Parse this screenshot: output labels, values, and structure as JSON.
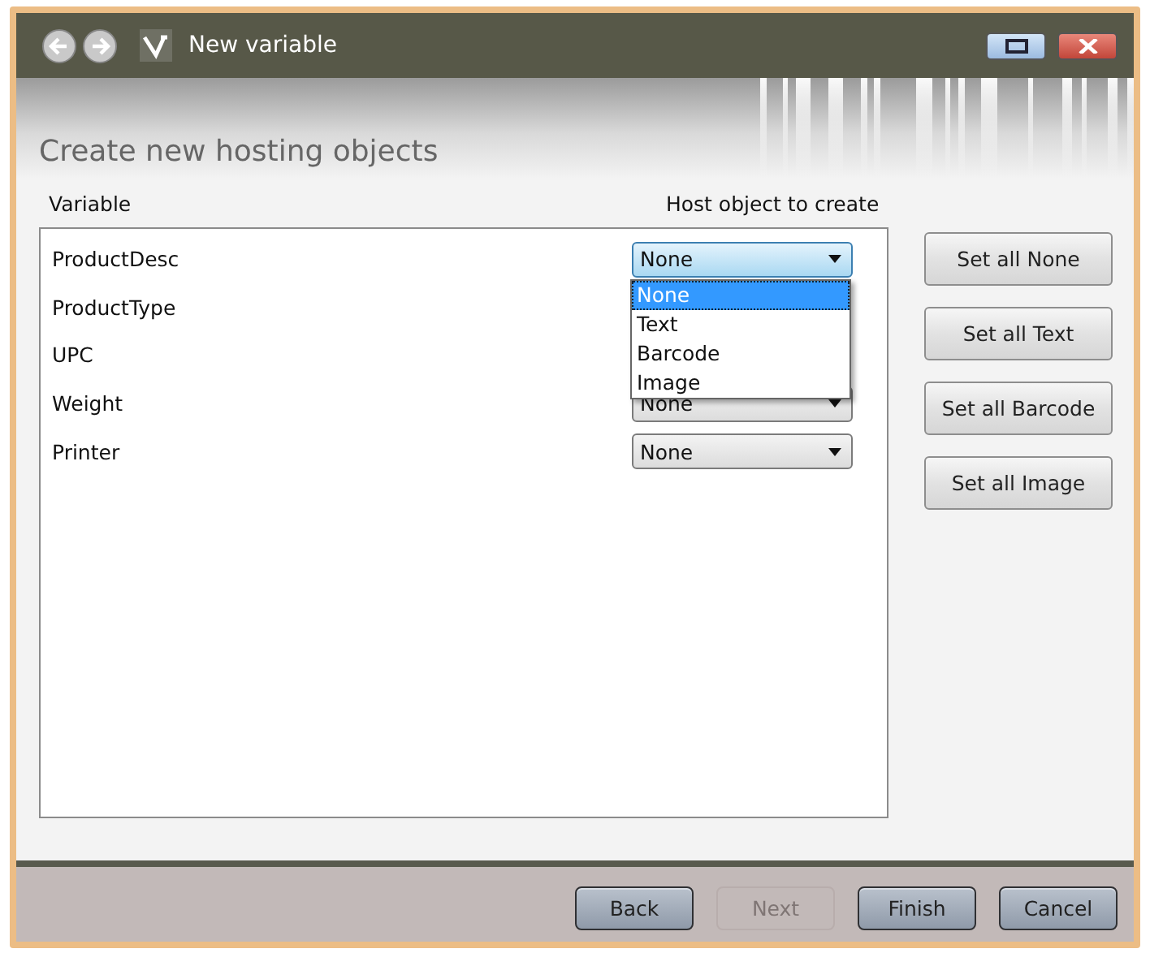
{
  "window": {
    "title": "New variable"
  },
  "header": {
    "title": "Create new hosting objects"
  },
  "columns": [
    "Variable",
    "Host object to create"
  ],
  "rows": [
    {
      "name": "ProductDesc",
      "combo": {
        "value": "None",
        "open": true
      }
    },
    {
      "name": "ProductType"
    },
    {
      "name": "UPC"
    },
    {
      "name": "Weight",
      "combo": {
        "value": "None",
        "open": false
      }
    },
    {
      "name": "Printer",
      "combo": {
        "value": "None",
        "open": false
      }
    }
  ],
  "dropdown": {
    "options": [
      {
        "label": "None",
        "selected": true
      },
      {
        "label": "Text",
        "selected": false
      },
      {
        "label": "Barcode",
        "selected": false
      },
      {
        "label": "Image",
        "selected": false
      }
    ]
  },
  "side_buttons": [
    "Set all None",
    "Set all Text",
    "Set all Barcode",
    "Set all Image"
  ],
  "footer_buttons": [
    {
      "label": "Back",
      "disabled": false
    },
    {
      "label": "Next",
      "disabled": true
    },
    {
      "label": "Finish",
      "disabled": false
    },
    {
      "label": "Cancel",
      "disabled": false
    }
  ]
}
